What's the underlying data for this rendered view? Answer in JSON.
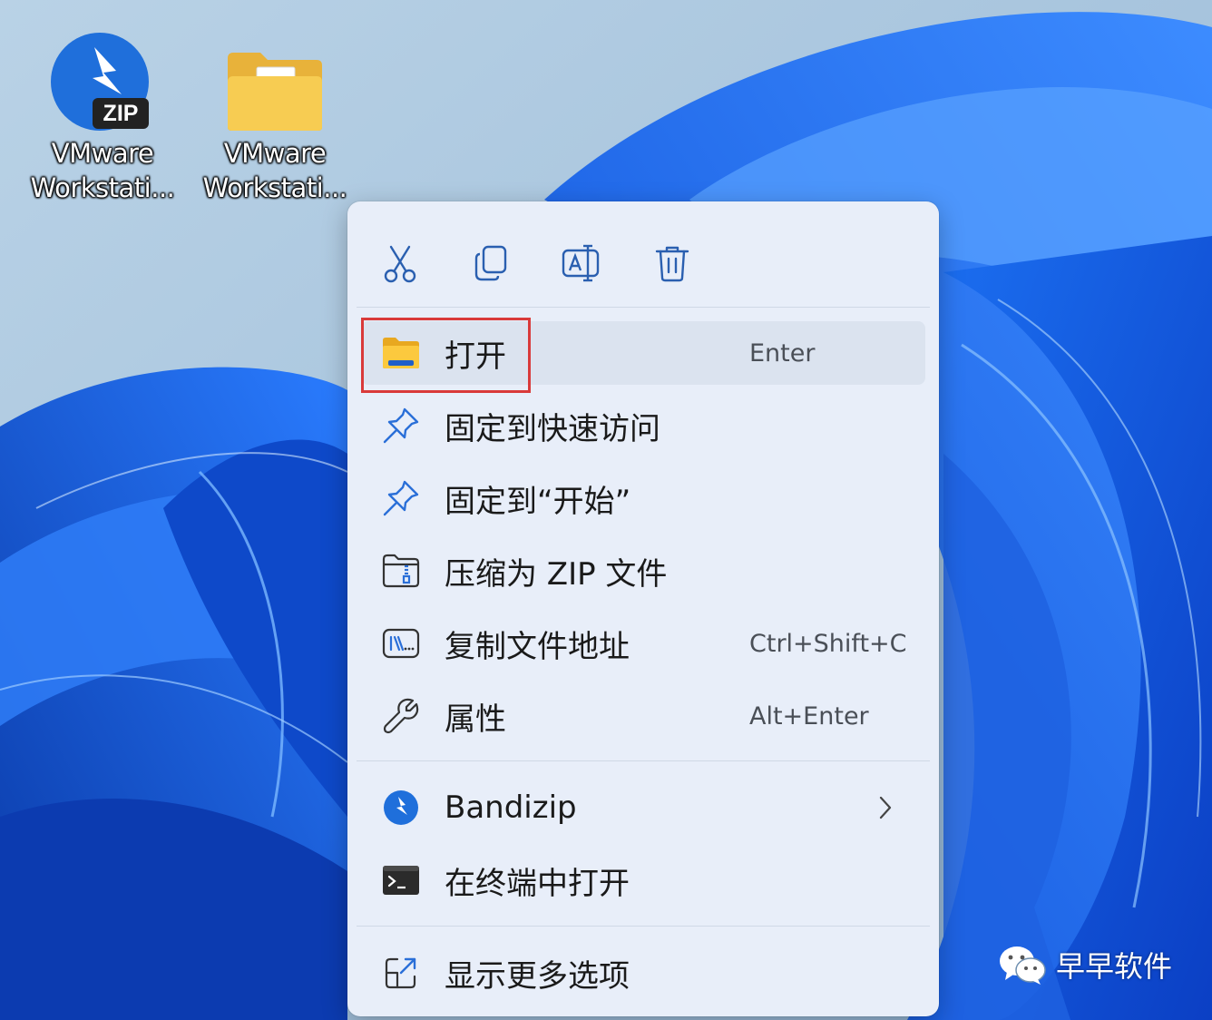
{
  "desktop": {
    "icons": [
      {
        "label_line1": "VMware",
        "label_line2": "Workstati...",
        "icon": "bandizip-zip-archive-icon"
      },
      {
        "label_line1": "VMware",
        "label_line2": "Workstati...",
        "icon": "folder-icon"
      }
    ],
    "zip_badge_text": "ZIP"
  },
  "context_menu": {
    "quick_actions": [
      {
        "name": "cut",
        "icon": "scissors-icon"
      },
      {
        "name": "copy",
        "icon": "copy-icon"
      },
      {
        "name": "rename",
        "icon": "rename-icon"
      },
      {
        "name": "delete",
        "icon": "trash-icon"
      }
    ],
    "items": [
      {
        "label": "打开",
        "shortcut": "Enter",
        "icon": "folder-open-icon",
        "highlighted": true
      },
      {
        "label": "固定到快速访问",
        "shortcut": "",
        "icon": "pin-icon"
      },
      {
        "label": "固定到“开始”",
        "shortcut": "",
        "icon": "pin-icon"
      },
      {
        "label": "压缩为 ZIP 文件",
        "shortcut": "",
        "icon": "zip-compress-icon"
      },
      {
        "label": "复制文件地址",
        "shortcut": "Ctrl+Shift+C",
        "icon": "copy-path-icon"
      },
      {
        "label": "属性",
        "shortcut": "Alt+Enter",
        "icon": "wrench-icon"
      },
      {
        "label": "Bandizip",
        "shortcut": "",
        "icon": "bandizip-icon",
        "has_submenu": true
      },
      {
        "label": "在终端中打开",
        "shortcut": "",
        "icon": "terminal-icon"
      },
      {
        "label": "显示更多选项",
        "shortcut": "",
        "icon": "show-more-icon"
      }
    ]
  },
  "watermark": {
    "text": "早早软件",
    "icon": "wechat-icon"
  },
  "colors": {
    "accent_blue": "#1a73e8",
    "highlight_red": "#d93a3a",
    "menu_bg": "#e8eef9"
  }
}
